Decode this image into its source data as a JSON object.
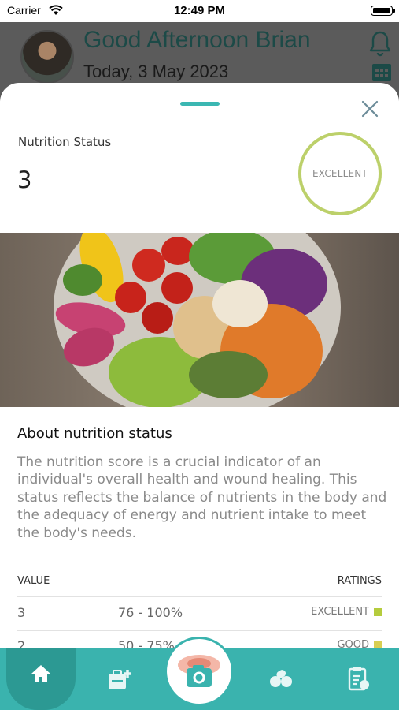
{
  "status_bar": {
    "carrier": "Carrier",
    "time": "12:49 PM"
  },
  "header": {
    "greeting": "Good Afternoon Brian",
    "date": "Today, 3 May 2023"
  },
  "sheet": {
    "nutrition_label": "Nutrition Status",
    "nutrition_value": "3",
    "rating": "EXCELLENT",
    "about_title": "About nutrition status",
    "about_body": "The nutrition score is a crucial indicator of an individual's overall health and wound healing. This status reflects the balance of nutrients in the body and the adequacy of energy and nutrient intake to meet the body's needs.",
    "table": {
      "value_header": "VALUE",
      "ratings_header": "RATINGS",
      "rows": [
        {
          "value": "3",
          "range": "76 - 100%",
          "rating": "EXCELLENT",
          "color": "#b5cc3d"
        },
        {
          "value": "2",
          "range": "50 - 75%",
          "rating": "GOOD",
          "color": "#d8cf52"
        }
      ]
    }
  },
  "tabbar": {
    "items": [
      "home-icon",
      "medical-kit-icon",
      "camera-icon",
      "pills-icon",
      "clipboard-food-icon"
    ],
    "accent": "#3ab3ae"
  }
}
